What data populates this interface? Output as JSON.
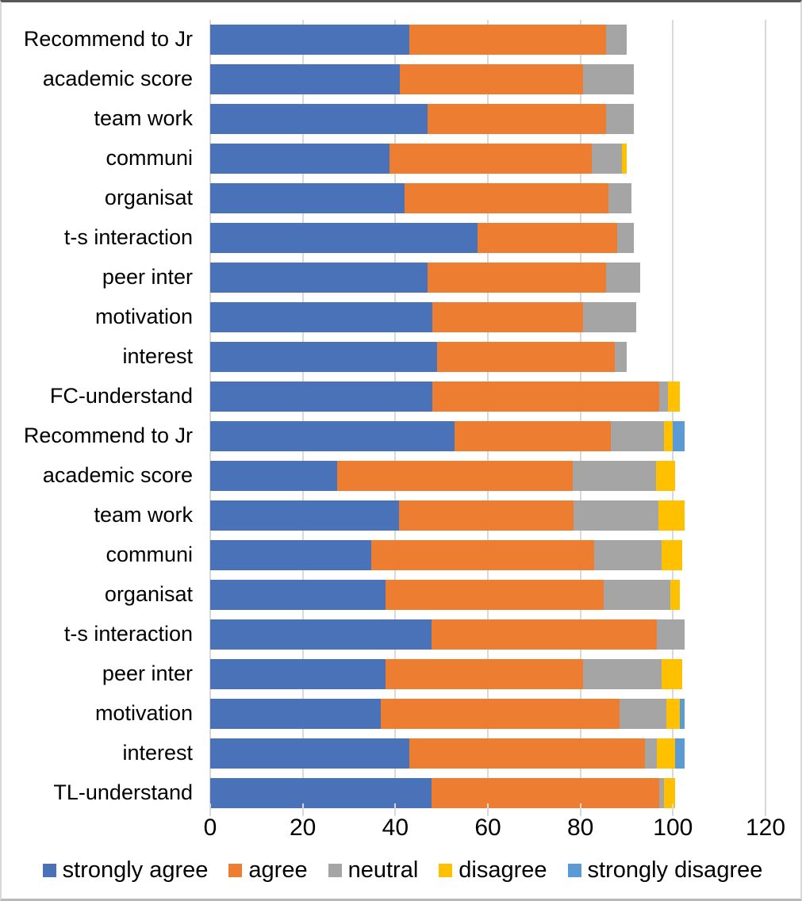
{
  "chart_data": {
    "type": "bar",
    "orientation": "horizontal",
    "stacked": true,
    "title": "",
    "xlabel": "",
    "ylabel": "",
    "xlim": [
      0,
      120
    ],
    "xticks": [
      0,
      20,
      40,
      60,
      80,
      100,
      120
    ],
    "xtick_labels": [
      "0",
      "20",
      "40",
      "60",
      "80",
      "100",
      "120"
    ],
    "grid": true,
    "legend_position": "bottom",
    "categories": [
      "TL-understand",
      "interest",
      "motivation",
      "peer inter",
      "t-s interaction",
      "organisat",
      "communi",
      "team work",
      "academic score",
      "Recommend to Jr",
      "FC-understand",
      "interest",
      "motivation",
      "peer inter",
      "t-s interaction",
      "organisat",
      "communi",
      "team work",
      "academic score",
      "Recommend to Jr"
    ],
    "series": [
      {
        "name": "strongly agree",
        "color": "#4a72b8",
        "values": [
          47.8,
          43.0,
          36.8,
          37.8,
          47.8,
          37.8,
          34.8,
          40.8,
          27.4,
          52.8,
          48.0,
          49.0,
          48.0,
          47.0,
          57.8,
          42.0,
          38.8,
          47.0,
          41.0,
          43.0
        ]
      },
      {
        "name": "agree",
        "color": "#ed7d31",
        "values": [
          49.2,
          51.0,
          51.7,
          42.7,
          48.7,
          47.2,
          48.2,
          37.7,
          51.0,
          33.7,
          49.0,
          38.5,
          32.5,
          38.5,
          30.2,
          44.0,
          43.7,
          38.5,
          39.5,
          42.5
        ]
      },
      {
        "name": "neutral",
        "color": "#a5a5a5",
        "values": [
          1.0,
          2.5,
          10.0,
          17.0,
          6.0,
          14.5,
          14.5,
          18.3,
          18.0,
          11.5,
          2.0,
          2.5,
          11.5,
          7.5,
          3.5,
          5.0,
          6.5,
          6.0,
          11.0,
          4.5
        ]
      },
      {
        "name": "disagree",
        "color": "#ffc000",
        "values": [
          2.5,
          4.0,
          3.0,
          4.5,
          0.0,
          2.0,
          4.5,
          5.7,
          4.0,
          2.0,
          2.5,
          0.0,
          0.0,
          0.0,
          0.0,
          0.0,
          1.0,
          0.0,
          0.0,
          0.0
        ]
      },
      {
        "name": "strongly disagree",
        "color": "#5b9bd5",
        "values": [
          0.0,
          2.0,
          1.0,
          0.0,
          0.0,
          0.0,
          0.0,
          0.0,
          0.0,
          2.5,
          0.0,
          0.0,
          0.0,
          0.0,
          0.0,
          0.0,
          0.0,
          0.0,
          0.0,
          0.0
        ]
      }
    ]
  },
  "legend": {
    "items": [
      {
        "label": "strongly agree",
        "color": "#4a72b8"
      },
      {
        "label": "agree",
        "color": "#ed7d31"
      },
      {
        "label": "neutral",
        "color": "#a5a5a5"
      },
      {
        "label": "disagree",
        "color": "#ffc000"
      },
      {
        "label": "strongly disagree",
        "color": "#5b9bd5"
      }
    ]
  }
}
